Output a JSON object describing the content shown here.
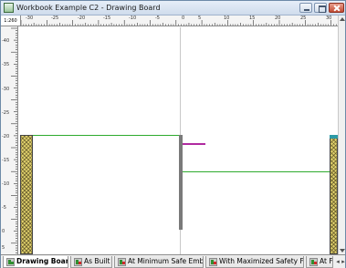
{
  "window": {
    "title": "Workbook Example C2 - Drawing Board"
  },
  "scale": "1:260",
  "ruler_top": {
    "labels": [
      "-30",
      "-25",
      "-20",
      "-15",
      "-10",
      "-5",
      "0",
      "5",
      "10",
      "15",
      "20",
      "25",
      "30"
    ]
  },
  "ruler_left": {
    "labels": [
      "-40",
      "-35",
      "-30",
      "-25",
      "-20",
      "-15",
      "-10",
      "-5",
      "0",
      "5",
      "10"
    ]
  },
  "tabs": [
    {
      "label": "Drawing Board",
      "active": true,
      "icon": "drawing-board-icon"
    },
    {
      "label": "As Built",
      "active": false,
      "icon": "chart-icon"
    },
    {
      "label": "At Minimum Safe Embedment",
      "active": false,
      "icon": "chart-icon"
    },
    {
      "label": "With Maximized Safety Factors",
      "active": false,
      "icon": "chart-icon"
    },
    {
      "label": "At Fai",
      "active": false,
      "icon": "chart-icon"
    }
  ],
  "colors": {
    "ground_line": "#2eaa2e",
    "anchor_line": "#b02aa0",
    "wall": "#7a7a7a",
    "soil_fill": "#e1d26d",
    "soil_top": "#2d9aa6",
    "centerline": "#c8c8c8"
  }
}
